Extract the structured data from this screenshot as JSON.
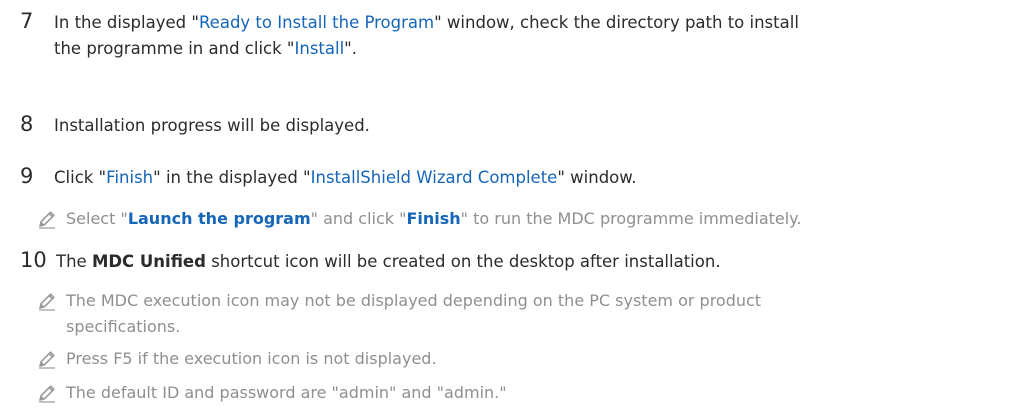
{
  "steps": [
    {
      "num": "7",
      "line_a_1": "In the displayed \"",
      "line_a_hl": "Ready to Install the Program",
      "line_a_2": "\" window, check the directory path to install",
      "line_b_1": "the programme in and click \"",
      "line_b_hl": "Install",
      "line_b_2": "\"."
    },
    {
      "num": "8",
      "text": "Installation progress will be displayed."
    },
    {
      "num": "9",
      "t1": "Click \"",
      "hl1": "Finish",
      "t2": "\" in the displayed \"",
      "hl2": "InstallShield Wizard Complete",
      "t3": "\" window.",
      "note": {
        "icon": "pencil-icon",
        "t1": "Select \"",
        "hl1": "Launch the program",
        "t2": "\" and click \"",
        "hl2": "Finish",
        "t3": "\" to run the MDC programme immediately."
      }
    },
    {
      "num": "10",
      "t1": "The ",
      "strong": "MDC Unified",
      "t2": " shortcut icon will be created on the desktop after installation.",
      "notes": [
        {
          "icon": "pencil-icon",
          "line1": "The MDC execution icon may not be displayed depending on the PC system or product",
          "line2": "specifications."
        },
        {
          "icon": "pencil-icon",
          "text": "Press F5 if the execution icon is not displayed."
        },
        {
          "icon": "pencil-icon",
          "text": "The default ID and password are \"admin\" and \"admin.\""
        }
      ]
    }
  ],
  "colors": {
    "text": "#2b2b2b",
    "highlight": "#1565b8",
    "note_text": "#8f8f8f",
    "icon": "#999999"
  }
}
